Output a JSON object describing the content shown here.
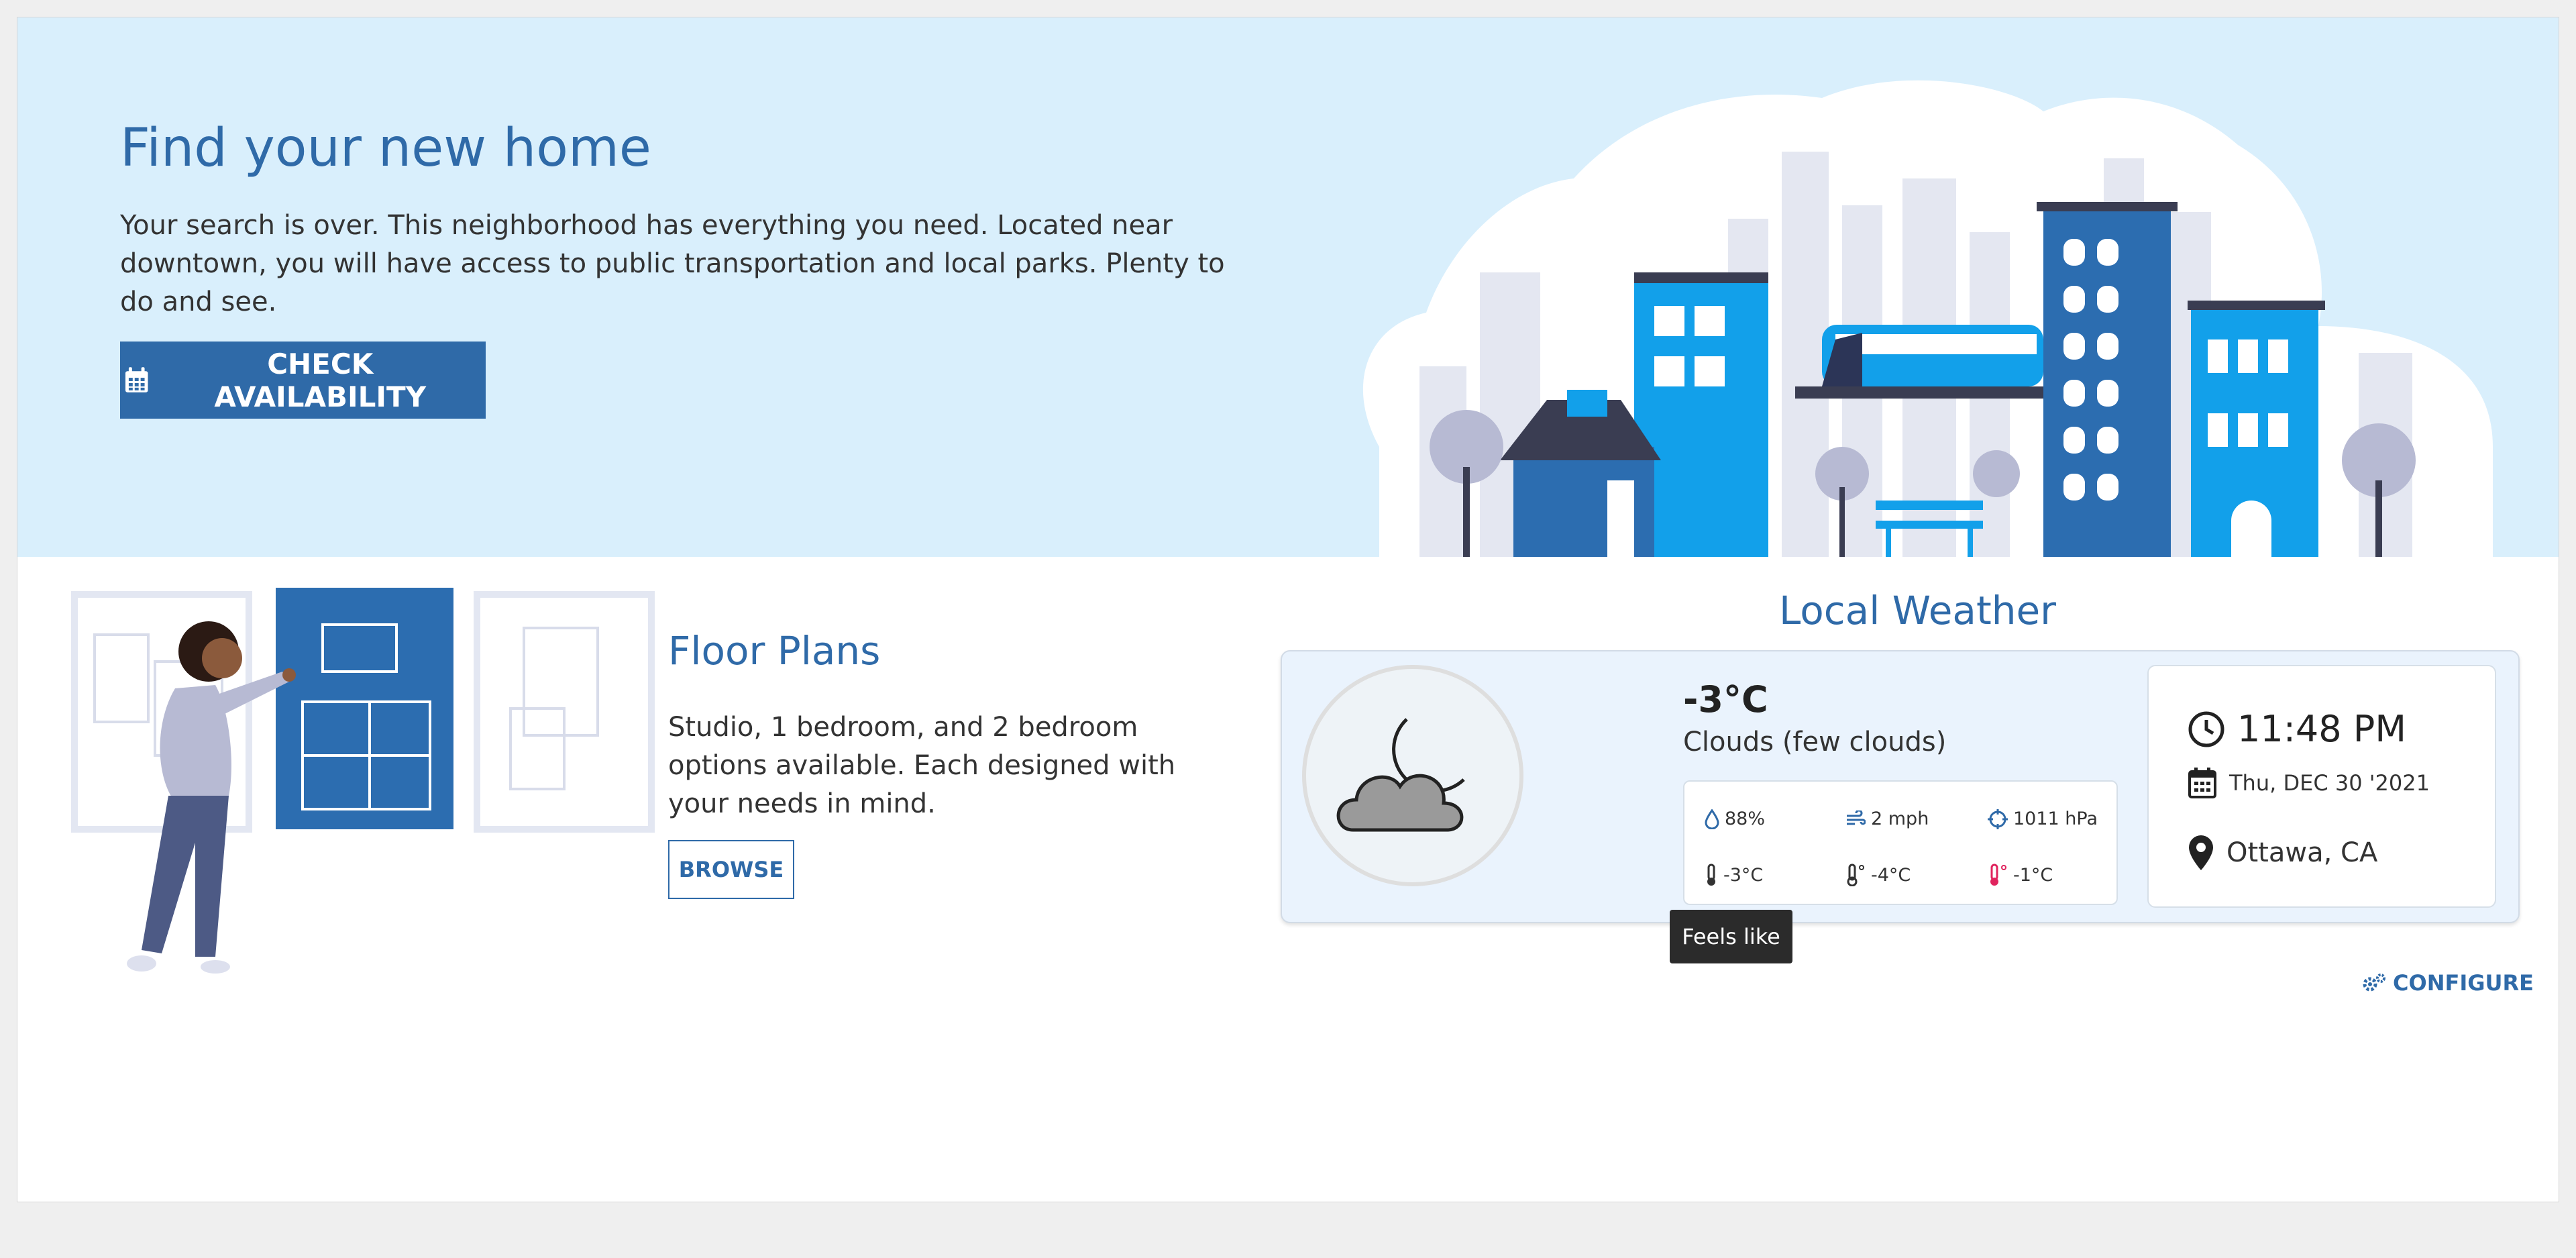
{
  "hero": {
    "title": "Find your new home",
    "body": "Your search is over. This neighborhood has everything you need. Located near downtown, you will have access to public transportation and local parks. Plenty to do and see.",
    "cta_label": "CHECK AVAILABILITY",
    "cta_icon": "calendar-icon"
  },
  "floor_plans": {
    "title": "Floor Plans",
    "body": "Studio, 1 bedroom, and 2 bedroom options available. Each designed with your needs in mind.",
    "button_label": "BROWSE"
  },
  "weather": {
    "title": "Local Weather",
    "temp": "-3°C",
    "description": "Clouds (few clouds)",
    "icon": "partly-cloudy-night-icon",
    "stats": {
      "humidity": "88%",
      "wind": "2 mph",
      "pressure": "1011 hPa",
      "feels_like": "-3°C",
      "min": "-4°C",
      "max": "-1°C"
    },
    "time": "11:48 PM",
    "date": "Thu, DEC 30 '2021",
    "location": "Ottawa, CA",
    "tooltip": "Feels like",
    "configure_label": "CONFIGURE"
  },
  "colors": {
    "brand": "#2f6aa8",
    "hero_bg": "#d9effc",
    "accent_blue": "#12a0ea",
    "max_temp_red": "#e0245e"
  }
}
